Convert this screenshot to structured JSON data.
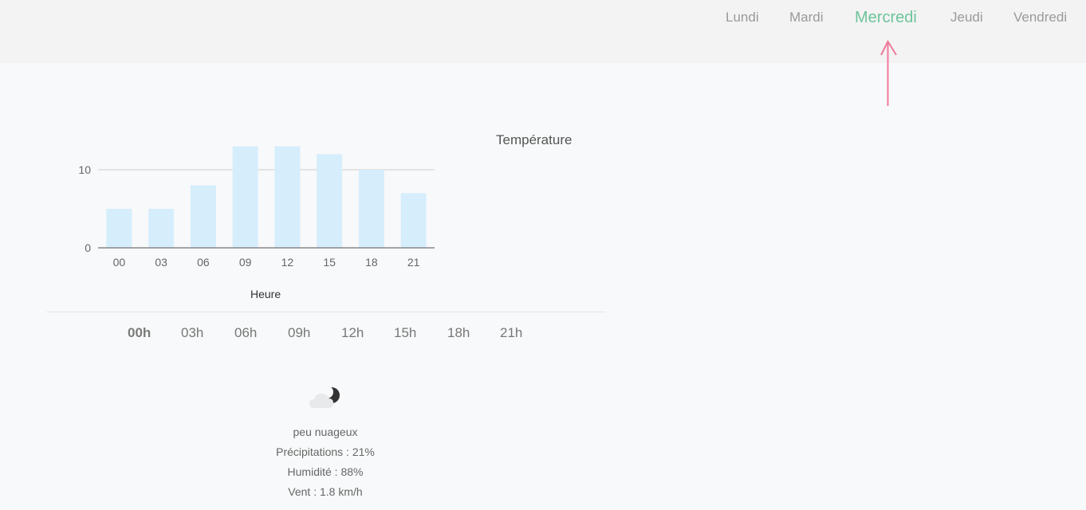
{
  "nav": {
    "days": [
      "Lundi",
      "Mardi",
      "Mercredi",
      "Jeudi",
      "Vendredi"
    ],
    "active_day": "Mercredi"
  },
  "chart_data": {
    "type": "bar",
    "title": "Température",
    "xlabel": "Heure",
    "ylabel": "",
    "categories": [
      "00",
      "03",
      "06",
      "09",
      "12",
      "15",
      "18",
      "21"
    ],
    "values": [
      5,
      5,
      8,
      13,
      13,
      12,
      10,
      7
    ],
    "ylim": [
      0,
      10
    ],
    "yticks": [
      0,
      10
    ],
    "grid": true,
    "bar_color": "#d6edfc"
  },
  "hours": {
    "tabs": [
      "00h",
      "03h",
      "06h",
      "09h",
      "12h",
      "15h",
      "18h",
      "21h"
    ],
    "active": "00h"
  },
  "details": {
    "icon": "cloud-moon-icon",
    "condition": "peu nuageux",
    "precipitation": "Précipitations : 21%",
    "humidity": "Humidité : 88%",
    "wind": "Vent : 1.8 km/h"
  },
  "colors": {
    "accent": "#6cc59a",
    "annotation_arrow": "#f07a9c"
  }
}
